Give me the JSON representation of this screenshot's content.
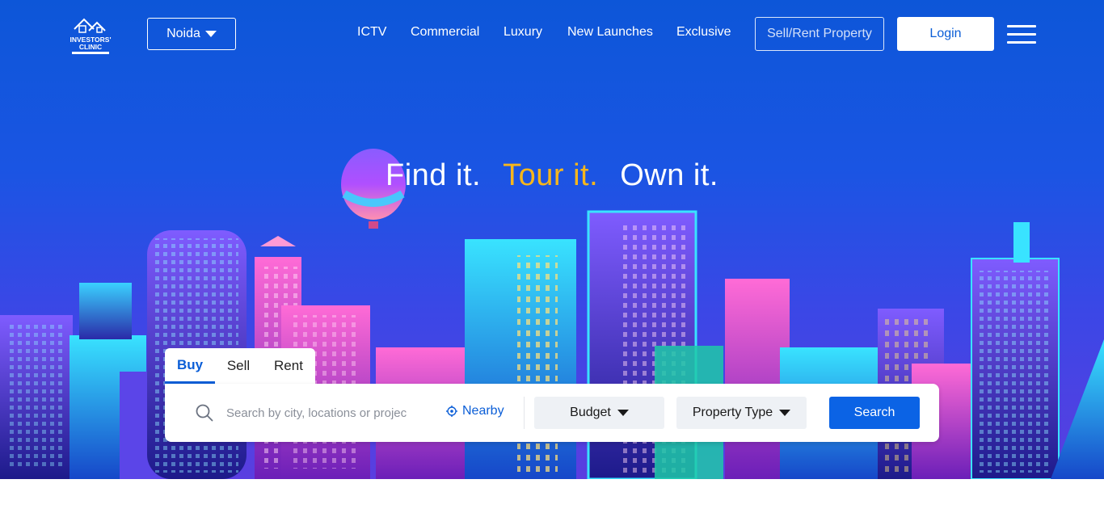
{
  "header": {
    "logo_text": "INVESTORS' CLINIC",
    "city": "Noida",
    "nav": [
      "ICTV",
      "Commercial",
      "Luxury",
      "New Launches",
      "Exclusive"
    ],
    "sell_rent_label": "Sell/Rent Property",
    "login_label": "Login"
  },
  "hero": {
    "tagline_1": "Find it.",
    "tagline_2": "Tour it.",
    "tagline_3": "Own it.",
    "highlight_color": "#f7b61b"
  },
  "search": {
    "tabs": [
      "Buy",
      "Sell",
      "Rent"
    ],
    "active_tab": "Buy",
    "placeholder": "Search by city, locations or projec",
    "nearby_label": "Nearby",
    "budget_label": "Budget",
    "property_type_label": "Property Type",
    "search_label": "Search"
  },
  "colors": {
    "primary": "#0b63e5",
    "accent": "#f7b61b"
  }
}
